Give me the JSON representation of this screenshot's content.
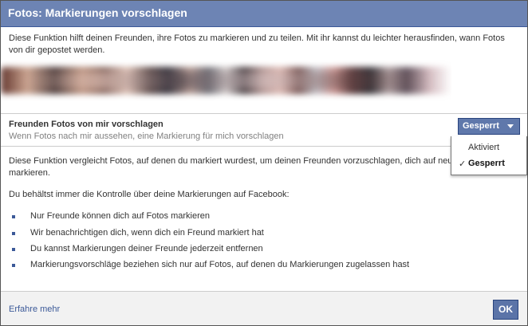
{
  "dialog": {
    "title": "Fotos: Markierungen vorschlagen",
    "intro_line1": "Diese Funktion hilft deinen Freunden, ihre Fotos zu markieren und zu teilen. Mit ihr kannst du leichter herausfinden, wann Fotos",
    "intro_line2": "von dir gepostet werden."
  },
  "setting": {
    "label": "Freunden Fotos von mir vorschlagen",
    "sublabel": "Wenn Fotos nach mir aussehen, eine Markierung für mich vorschlagen",
    "selected_value": "Gesperrt",
    "options": [
      {
        "label": "Aktiviert",
        "selected": false
      },
      {
        "label": "Gesperrt",
        "selected": true
      }
    ],
    "check_glyph": "✓"
  },
  "body": {
    "para1_line1": "Diese Funktion vergleicht Fotos, auf denen du markiert wurdest, um deinen Freunden vorzuschlagen, dich auf neu",
    "para1_line2": "markieren.",
    "para2": "Du behältst immer die Kontrolle über deine Markierungen auf Facebook:",
    "bullets": [
      "Nur Freunde können dich auf Fotos markieren",
      "Wir benachrichtigen dich, wenn dich ein Freund markiert hat",
      "Du kannst Markierungen deiner Freunde jederzeit entfernen",
      "Markierungsvorschläge beziehen sich nur auf Fotos, auf denen du Markierungen zugelassen hast"
    ]
  },
  "footer": {
    "learn_more": "Erfahre mehr",
    "ok_label": "OK"
  },
  "colors": {
    "titlebar": "#6d84b4",
    "accent": "#3b5998",
    "button": "#5f78ab"
  }
}
